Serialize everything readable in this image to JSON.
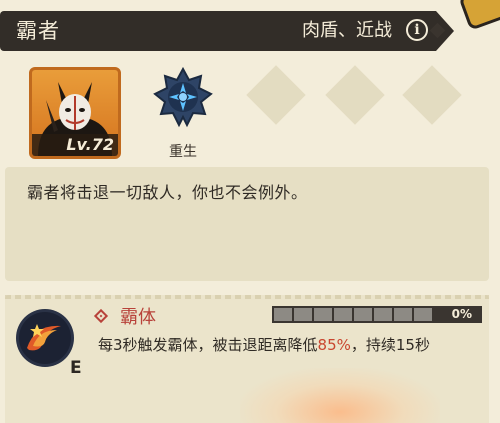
{
  "header": {
    "hero_name": "霸者",
    "role_tags": "肉盾、近战",
    "info_icon": "info-icon",
    "info_glyph": "i"
  },
  "portrait": {
    "icon": "rabbit-mask-warrior-portrait",
    "level": "Lv.72",
    "frame_color": "#c06a1e"
  },
  "skills": {
    "rebirth": {
      "icon": "rebirth-star-icon",
      "label": "重生"
    },
    "empty_slots": [
      "empty-slot",
      "empty-slot",
      "empty-slot"
    ]
  },
  "description": "霸者将击退一切敌人，你也不会例外。",
  "passive": {
    "icon": "fire-swirl-icon",
    "grade": "E",
    "name": "霸体",
    "progress_value": 0,
    "progress_text": "0%",
    "desc_before": "每3秒触发霸体，被击退距离降低",
    "desc_highlight": "85%",
    "desc_after": "，持续15秒",
    "highlight_color": "#c9462f"
  },
  "colors": {
    "header_bg": "#322d28",
    "panel_bg": "#f3edda",
    "accent_red": "#b8423a",
    "progress_fill": "#e4a83a"
  }
}
